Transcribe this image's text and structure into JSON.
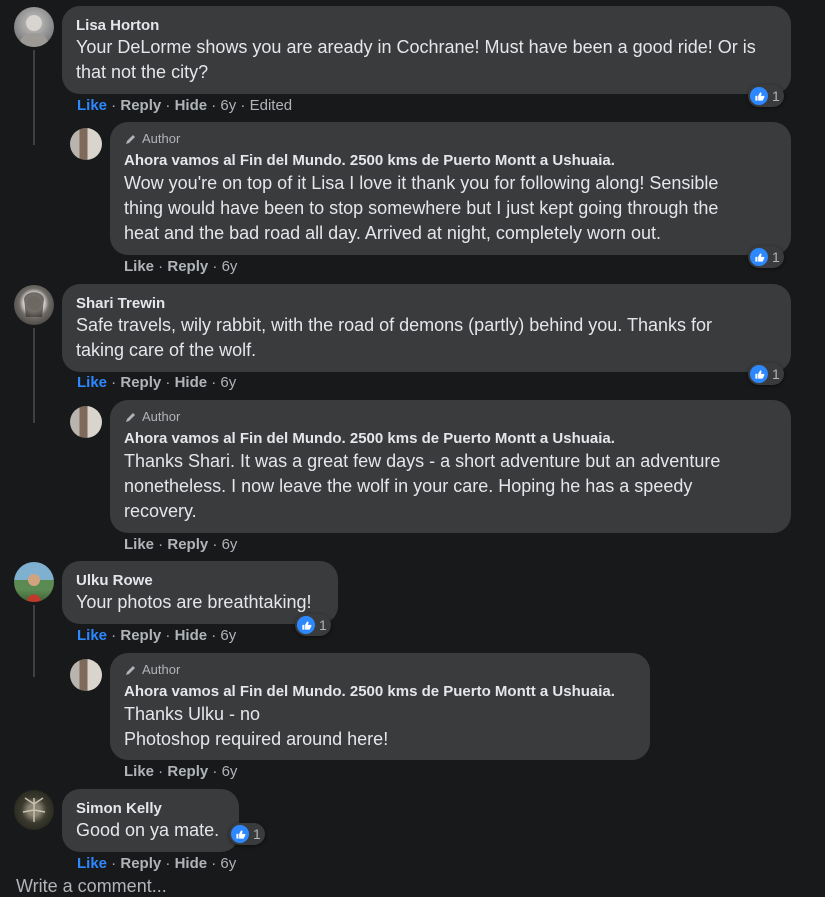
{
  "colors": {
    "background": "#18191a",
    "bubble": "#3a3b3c",
    "link_blue": "#2d88ff",
    "muted": "#b0b3b8"
  },
  "author_tag": "Author",
  "page_name": "Ahora vamos al Fin del Mundo. 2500 kms de Puerto Montt a Ushuaia.",
  "comments": [
    {
      "name": "Lisa Horton",
      "text_lines": [
        "Your DeLorme shows you are aready in Cochrane! Must have been a good ride! Or is",
        "that not the city?"
      ],
      "actions": {
        "like": "Like",
        "reply": "Reply",
        "hide": "Hide",
        "time": "6y",
        "edited": "Edited"
      },
      "reactions": "1",
      "reply": {
        "text_lines": [
          "Wow you're on top of it Lisa I love it thank you for following along! Sensible",
          "thing would have been to stop somewhere but I just kept going through the",
          "heat and the bad road all day. Arrived at night, completely worn out."
        ],
        "actions": {
          "like": "Like",
          "reply": "Reply",
          "time": "6y"
        },
        "reactions": "1"
      }
    },
    {
      "name": "Shari Trewin",
      "text_lines": [
        "Safe travels, wily rabbit, with the road of demons (partly) behind you. Thanks for",
        "taking care of the wolf."
      ],
      "actions": {
        "like": "Like",
        "reply": "Reply",
        "hide": "Hide",
        "time": "6y"
      },
      "reactions": "1",
      "reply": {
        "text_lines": [
          "Thanks Shari. It was a great few days - a short adventure but an adventure",
          "nonetheless. I now leave the wolf in your care. Hoping he has a speedy",
          "recovery."
        ],
        "actions": {
          "like": "Like",
          "reply": "Reply",
          "time": "6y"
        }
      }
    },
    {
      "name": "Ulku Rowe",
      "text_lines": [
        "Your photos are breathtaking!"
      ],
      "actions": {
        "like": "Like",
        "reply": "Reply",
        "hide": "Hide",
        "time": "6y"
      },
      "reactions": "1",
      "reply": {
        "text_lines": [
          "Thanks Ulku - no",
          "Photoshop required around here!"
        ],
        "actions": {
          "like": "Like",
          "reply": "Reply",
          "time": "6y"
        }
      }
    },
    {
      "name": "Simon Kelly",
      "text_lines": [
        "Good on ya mate."
      ],
      "actions": {
        "like": "Like",
        "reply": "Reply",
        "hide": "Hide",
        "time": "6y"
      },
      "reactions": "1"
    }
  ],
  "write_comment_placeholder": "Write a comment..."
}
